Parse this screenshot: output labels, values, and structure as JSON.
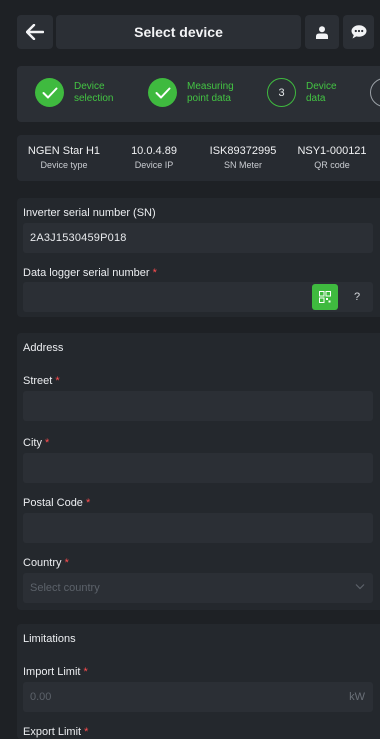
{
  "header": {
    "title": "Select device",
    "back_icon": "arrow-left-icon",
    "user_icon": "user-icon",
    "chat_icon": "chat-bubble-icon"
  },
  "stepper": {
    "steps": [
      {
        "label": "Device\nselection",
        "state": "done"
      },
      {
        "label": "Measuring\npoint data",
        "state": "done"
      },
      {
        "number": "3",
        "label": "Device\ndata",
        "state": "current"
      }
    ]
  },
  "info": [
    {
      "value": "NGEN Star H1",
      "label": "Device type"
    },
    {
      "value": "10.0.4.89",
      "label": "Device IP"
    },
    {
      "value": "ISK89372995",
      "label": "SN Meter"
    },
    {
      "value": "NSY1-000121",
      "label": "QR code"
    }
  ],
  "serials": {
    "inverter_label": "Inverter serial number (SN)",
    "inverter_value": "2A3J1530459P018",
    "logger_label": "Data logger serial number",
    "logger_value": "",
    "help": "?"
  },
  "address": {
    "title": "Address",
    "street_label": "Street",
    "city_label": "City",
    "postal_label": "Postal Code",
    "country_label": "Country",
    "country_placeholder": "Select country"
  },
  "limitations": {
    "title": "Limitations",
    "import_label": "Import Limit",
    "import_placeholder": "0.00",
    "import_unit": "kW",
    "export_label": "Export Limit"
  },
  "required_mark": "*",
  "colors": {
    "accent": "#3fba3f",
    "required": "#ff4d4f",
    "background": "#1e2125",
    "card": "#24282d"
  }
}
